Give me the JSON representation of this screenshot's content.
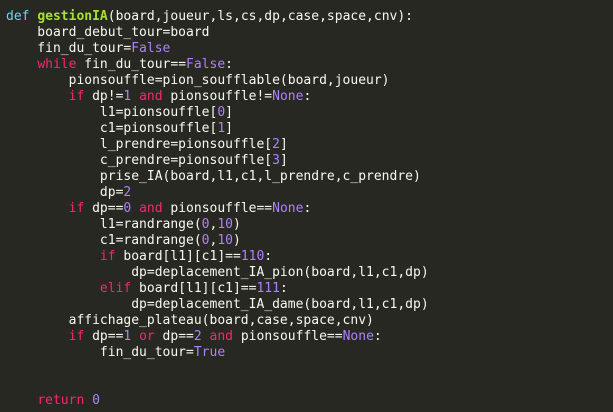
{
  "colors": {
    "background": "#272822",
    "text": "#f8f8f2",
    "keyword_def": "#66d9ef",
    "keyword_control": "#f92672",
    "function_name": "#a6e22e",
    "number": "#ae81ff",
    "constant": "#ae81ff"
  },
  "code": {
    "lines": [
      [
        {
          "t": "def",
          "c": "kw"
        },
        {
          "t": " "
        },
        {
          "t": "gestionIA",
          "c": "fn"
        },
        {
          "t": "(board,joueur,ls,cs,dp,case,space,cnv):"
        }
      ],
      [
        {
          "t": "    board_debut_tour=board"
        }
      ],
      [
        {
          "t": "    fin_du_tour="
        },
        {
          "t": "False",
          "c": "bool"
        }
      ],
      [
        {
          "t": "    "
        },
        {
          "t": "while",
          "c": "kwp"
        },
        {
          "t": " fin_du_tour=="
        },
        {
          "t": "False",
          "c": "bool"
        },
        {
          "t": ":"
        }
      ],
      [
        {
          "t": "        pionsouffle=pion_soufflable(board,joueur)"
        }
      ],
      [
        {
          "t": "        "
        },
        {
          "t": "if",
          "c": "kwp"
        },
        {
          "t": " dp!="
        },
        {
          "t": "1",
          "c": "num"
        },
        {
          "t": " "
        },
        {
          "t": "and",
          "c": "kwp"
        },
        {
          "t": " pionsouffle!="
        },
        {
          "t": "None",
          "c": "bool"
        },
        {
          "t": ":"
        }
      ],
      [
        {
          "t": "            l1=pionsouffle["
        },
        {
          "t": "0",
          "c": "num"
        },
        {
          "t": "]"
        }
      ],
      [
        {
          "t": "            c1=pionsouffle["
        },
        {
          "t": "1",
          "c": "num"
        },
        {
          "t": "]"
        }
      ],
      [
        {
          "t": "            l_prendre=pionsouffle["
        },
        {
          "t": "2",
          "c": "num"
        },
        {
          "t": "]"
        }
      ],
      [
        {
          "t": "            c_prendre=pionsouffle["
        },
        {
          "t": "3",
          "c": "num"
        },
        {
          "t": "]"
        }
      ],
      [
        {
          "t": "            prise_IA(board,l1,c1,l_prendre,c_prendre)"
        }
      ],
      [
        {
          "t": "            dp="
        },
        {
          "t": "2",
          "c": "num"
        }
      ],
      [
        {
          "t": "        "
        },
        {
          "t": "if",
          "c": "kwp"
        },
        {
          "t": " dp=="
        },
        {
          "t": "0",
          "c": "num"
        },
        {
          "t": " "
        },
        {
          "t": "and",
          "c": "kwp"
        },
        {
          "t": " pionsouffle=="
        },
        {
          "t": "None",
          "c": "bool"
        },
        {
          "t": ":"
        }
      ],
      [
        {
          "t": "            l1=randrange("
        },
        {
          "t": "0",
          "c": "num"
        },
        {
          "t": ","
        },
        {
          "t": "10",
          "c": "num"
        },
        {
          "t": ")"
        }
      ],
      [
        {
          "t": "            c1=randrange("
        },
        {
          "t": "0",
          "c": "num"
        },
        {
          "t": ","
        },
        {
          "t": "10",
          "c": "num"
        },
        {
          "t": ")"
        }
      ],
      [
        {
          "t": "            "
        },
        {
          "t": "if",
          "c": "kwp"
        },
        {
          "t": " board[l1][c1]=="
        },
        {
          "t": "110",
          "c": "num"
        },
        {
          "t": ":"
        }
      ],
      [
        {
          "t": "                dp=deplacement_IA_pion(board,l1,c1,dp)"
        }
      ],
      [
        {
          "t": "            "
        },
        {
          "t": "elif",
          "c": "kwp"
        },
        {
          "t": " board[l1][c1]=="
        },
        {
          "t": "111",
          "c": "num"
        },
        {
          "t": ":"
        }
      ],
      [
        {
          "t": "                dp=deplacement_IA_dame(board,l1,c1,dp)"
        }
      ],
      [
        {
          "t": "        affichage_plateau(board,case,space,cnv)"
        }
      ],
      [
        {
          "t": "        "
        },
        {
          "t": "if",
          "c": "kwp"
        },
        {
          "t": " dp=="
        },
        {
          "t": "1",
          "c": "num"
        },
        {
          "t": " "
        },
        {
          "t": "or",
          "c": "kwp"
        },
        {
          "t": " dp=="
        },
        {
          "t": "2",
          "c": "num"
        },
        {
          "t": " "
        },
        {
          "t": "and",
          "c": "kwp"
        },
        {
          "t": " pionsouffle=="
        },
        {
          "t": "None",
          "c": "bool"
        },
        {
          "t": ":"
        }
      ],
      [
        {
          "t": "            fin_du_tour="
        },
        {
          "t": "True",
          "c": "bool"
        }
      ],
      [],
      [],
      [
        {
          "t": "    "
        },
        {
          "t": "return",
          "c": "kwp"
        },
        {
          "t": " "
        },
        {
          "t": "0",
          "c": "num"
        }
      ]
    ]
  }
}
